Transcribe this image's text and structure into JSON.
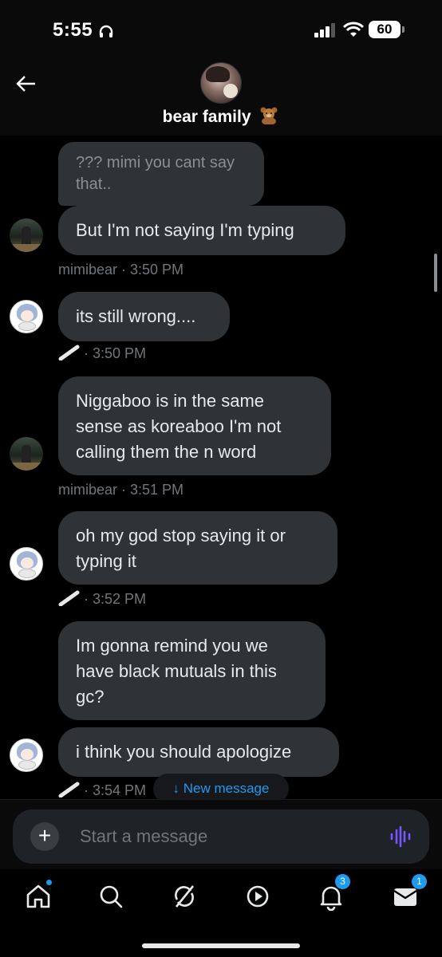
{
  "status_bar": {
    "time": "5:55",
    "battery": "60"
  },
  "header": {
    "title": "bear family"
  },
  "messages": [
    {
      "text": "??? mimi you cant say that..",
      "quoted": true
    },
    {
      "text": "But I'm not saying I'm typing",
      "sender": "mimibear",
      "time": "3:50 PM"
    },
    {
      "text": "its still wrong....",
      "time": "3:50 PM"
    },
    {
      "text": "Niggaboo is in the same sense as koreaboo I'm not calling them the n word",
      "sender": "mimibear",
      "time": "3:51 PM"
    },
    {
      "text": "oh my god stop saying it or typing it",
      "time": "3:52 PM"
    },
    {
      "text": "Im gonna remind you we have black mutuals in this gc?"
    },
    {
      "text": "i think you should apologize",
      "time": "3:54 PM"
    }
  ],
  "new_message_label": "↓ New message",
  "composer": {
    "placeholder": "Start a message"
  },
  "tabbar": {
    "notifications_badge": "3",
    "messages_badge": "1"
  },
  "icons": [
    "headphones-icon",
    "signal-icon",
    "wifi-icon",
    "battery-icon",
    "back-arrow-icon",
    "teddy-bear-icon",
    "check-icon",
    "plus-icon",
    "voice-icon",
    "home-icon",
    "search-icon",
    "grok-icon",
    "play-icon",
    "bell-icon",
    "mail-icon"
  ],
  "colors": {
    "accent": "#1d9bf0",
    "bubble": "#2f3336",
    "voice": "#7856ff"
  }
}
